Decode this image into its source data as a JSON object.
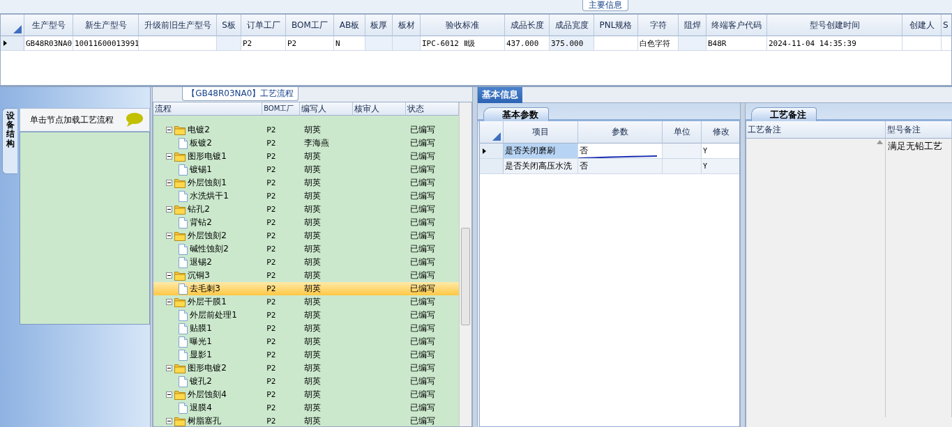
{
  "main_info": {
    "title": "主要信息",
    "columns": [
      "生产型号",
      "新生产型号",
      "升级前旧生产型号",
      "S板",
      "订单工厂",
      "BOM工厂",
      "AB板",
      "板厚",
      "板材",
      "验收标准",
      "成品长度",
      "成品宽度",
      "PNL规格",
      "字符",
      "阻焊",
      "终端客户代码",
      "型号创建时间",
      "创建人",
      "S"
    ],
    "rows": [
      {
        "selected": true,
        "cells": [
          "GB48R03NA0",
          "10011600013991",
          "",
          "",
          "P2",
          "P2",
          "N",
          "",
          "",
          "IPC-6012 Ⅱ级",
          "437.000",
          "375.000",
          "",
          "白色字符",
          "",
          "B48R",
          "2024-11-04 14:35:39",
          "",
          ""
        ]
      }
    ]
  },
  "side_tab": {
    "label": "设备结构",
    "selected": true
  },
  "side_panel": {
    "hint": "单击节点加载工艺流程"
  },
  "process_flow": {
    "title": "【GB48R03NA0】工艺流程",
    "columns": [
      "流程",
      "BOM工厂",
      "编写人",
      "核审人",
      "状态"
    ],
    "nodes": [
      {
        "kind": "folder",
        "name": "电镀2",
        "bom": "P2",
        "writer": "胡英",
        "status": "已编写",
        "selected": false,
        "expanded": true,
        "children": [
          {
            "kind": "step",
            "name": "板镀2",
            "bom": "P2",
            "writer": "李海燕",
            "status": "已编写",
            "selected": false
          }
        ]
      },
      {
        "kind": "folder",
        "name": "图形电镀1",
        "bom": "P2",
        "writer": "胡英",
        "status": "已编写",
        "selected": false,
        "expanded": true,
        "children": [
          {
            "kind": "step",
            "name": "镀锡1",
            "bom": "P2",
            "writer": "胡英",
            "status": "已编写",
            "selected": false
          }
        ]
      },
      {
        "kind": "folder",
        "name": "外层蚀刻1",
        "bom": "P2",
        "writer": "胡英",
        "status": "已编写",
        "selected": false,
        "expanded": true,
        "children": [
          {
            "kind": "step",
            "name": "水洗烘干1",
            "bom": "P2",
            "writer": "胡英",
            "status": "已编写",
            "selected": false
          }
        ]
      },
      {
        "kind": "folder",
        "name": "钻孔2",
        "bom": "P2",
        "writer": "胡英",
        "status": "已编写",
        "selected": false,
        "expanded": true,
        "children": [
          {
            "kind": "step",
            "name": "背钻2",
            "bom": "P2",
            "writer": "胡英",
            "status": "已编写",
            "selected": false
          }
        ]
      },
      {
        "kind": "folder",
        "name": "外层蚀刻2",
        "bom": "P2",
        "writer": "胡英",
        "status": "已编写",
        "selected": false,
        "expanded": true,
        "children": [
          {
            "kind": "step",
            "name": "碱性蚀刻2",
            "bom": "P2",
            "writer": "胡英",
            "status": "已编写",
            "selected": false
          },
          {
            "kind": "step",
            "name": "退锡2",
            "bom": "P2",
            "writer": "胡英",
            "status": "已编写",
            "selected": false
          }
        ]
      },
      {
        "kind": "folder",
        "name": "沉铜3",
        "bom": "P2",
        "writer": "胡英",
        "status": "已编写",
        "selected": false,
        "expanded": true,
        "children": [
          {
            "kind": "step",
            "name": "去毛刺3",
            "bom": "P2",
            "writer": "胡英",
            "status": "已编写",
            "selected": true
          }
        ]
      },
      {
        "kind": "folder",
        "name": "外层干膜1",
        "bom": "P2",
        "writer": "胡英",
        "status": "已编写",
        "selected": false,
        "expanded": true,
        "children": [
          {
            "kind": "step",
            "name": "外层前处理1",
            "bom": "P2",
            "writer": "胡英",
            "status": "已编写",
            "selected": false
          },
          {
            "kind": "step",
            "name": "贴膜1",
            "bom": "P2",
            "writer": "胡英",
            "status": "已编写",
            "selected": false
          },
          {
            "kind": "step",
            "name": "曝光1",
            "bom": "P2",
            "writer": "胡英",
            "status": "已编写",
            "selected": false
          },
          {
            "kind": "step",
            "name": "显影1",
            "bom": "P2",
            "writer": "胡英",
            "status": "已编写",
            "selected": false
          }
        ]
      },
      {
        "kind": "folder",
        "name": "图形电镀2",
        "bom": "P2",
        "writer": "胡英",
        "status": "已编写",
        "selected": false,
        "expanded": true,
        "children": [
          {
            "kind": "step",
            "name": "镀孔2",
            "bom": "P2",
            "writer": "胡英",
            "status": "已编写",
            "selected": false
          }
        ]
      },
      {
        "kind": "folder",
        "name": "外层蚀刻4",
        "bom": "P2",
        "writer": "胡英",
        "status": "已编写",
        "selected": false,
        "expanded": true,
        "children": [
          {
            "kind": "step",
            "name": "退膜4",
            "bom": "P2",
            "writer": "胡英",
            "status": "已编写",
            "selected": false
          }
        ]
      },
      {
        "kind": "folder",
        "name": "树脂塞孔",
        "bom": "P2",
        "writer": "胡英",
        "status": "已编写",
        "selected": false,
        "expanded": true
      }
    ]
  },
  "basic_info": {
    "tab": {
      "label": "基本信息",
      "selected": true
    },
    "subtab": {
      "label": "基本参数",
      "selected": true
    },
    "columns": [
      "项目",
      "参数",
      "单位",
      "修改"
    ],
    "rows": [
      {
        "item": "是否关闭磨刷",
        "param": "否",
        "unit": "",
        "modify": "Y",
        "selected": true
      },
      {
        "item": "是否关闭高压水洗",
        "param": "否",
        "unit": "",
        "modify": "Y",
        "selected": false
      }
    ]
  },
  "process_notes": {
    "tab": {
      "label": "工艺备注",
      "selected": true
    },
    "columns": [
      "工艺备注",
      "型号备注"
    ],
    "model_note": "满足无铅工艺"
  }
}
